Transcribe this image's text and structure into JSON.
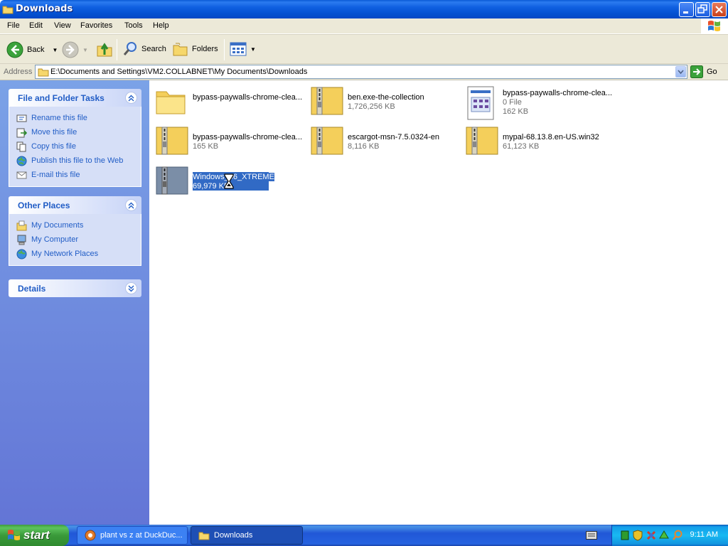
{
  "window": {
    "title": "Downloads"
  },
  "menu": [
    "File",
    "Edit",
    "View",
    "Favorites",
    "Tools",
    "Help"
  ],
  "toolbar": {
    "back": "Back",
    "search": "Search",
    "folders": "Folders"
  },
  "address": {
    "label": "Address",
    "path": "E:\\Documents and Settings\\VM2.COLLABNET\\My Documents\\Downloads",
    "go": "Go"
  },
  "tasks_pane": {
    "file_tasks": {
      "title": "File and Folder Tasks",
      "items": [
        "Rename this file",
        "Move this file",
        "Copy this file",
        "Publish this file to the Web",
        "E-mail this file"
      ]
    },
    "other_places": {
      "title": "Other Places",
      "items": [
        "My Documents",
        "My Computer",
        "My Network Places"
      ]
    },
    "details": {
      "title": "Details"
    }
  },
  "files": [
    {
      "name": "bypass-paywalls-chrome-clea...",
      "size": "",
      "type": "folder"
    },
    {
      "name": "ben.exe-the-collection",
      "size": "1,726,256 KB",
      "type": "zip"
    },
    {
      "name": "bypass-paywalls-chrome-clea...",
      "size": "0 File",
      "size2": "162 KB",
      "type": "doc"
    },
    {
      "name": "bypass-paywalls-chrome-clea...",
      "size": "165 KB",
      "type": "zip"
    },
    {
      "name": "escargot-msn-7.5.0324-en",
      "size": "8,116 KB",
      "type": "zip"
    },
    {
      "name": "mypal-68.13.8.en-US.win32",
      "size": "61,123 KB",
      "type": "zip"
    },
    {
      "name": "Windows_86_XTREME",
      "size": "69,979 KB",
      "type": "zip",
      "selected": true
    }
  ],
  "taskbar": {
    "start": "start",
    "buttons": [
      {
        "label": "plant vs z at DuckDuc..."
      },
      {
        "label": "Downloads"
      }
    ],
    "clock": "9:11 AM"
  },
  "colors": {
    "title_blue": "#0553d3",
    "selection": "#316ac5",
    "task_link": "#215dc6",
    "start_green": "#3a9a3a"
  }
}
